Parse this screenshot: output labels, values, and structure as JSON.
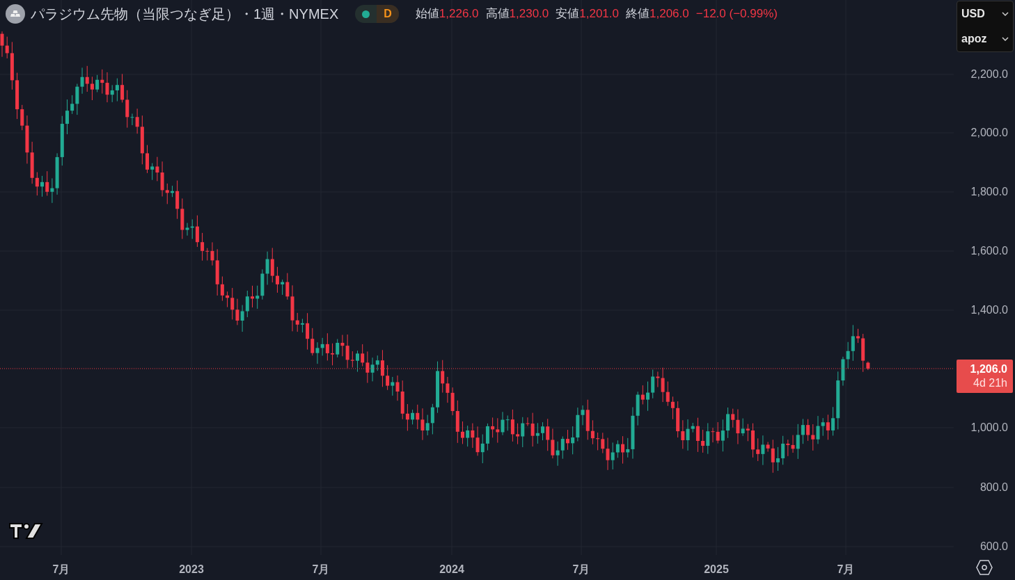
{
  "header": {
    "title": "パラジウム先物（当限つなぎ足）・1週・NYMEX",
    "status_badge": {
      "label": "D",
      "color": "#22ab94"
    },
    "ohlc": [
      {
        "label": "始値",
        "value": "1,226.0"
      },
      {
        "label": "高値",
        "value": "1,230.0"
      },
      {
        "label": "安値",
        "value": "1,201.0"
      },
      {
        "label": "終値",
        "value": "1,206.0"
      }
    ],
    "change": "−12.0 (−0.99%)"
  },
  "selectors": [
    "USD",
    "apoz"
  ],
  "price_axis": [
    "2,200.0",
    "2,000.0",
    "1,800.0",
    "1,600.0",
    "1,400.0",
    "1,000.0",
    "800.0",
    "600.0"
  ],
  "last_price": {
    "price": "1,206.0",
    "countdown": "4d 21h"
  },
  "time_axis": [
    "7月",
    "2023",
    "7月",
    "2024",
    "7月",
    "2025",
    "7月"
  ]
}
